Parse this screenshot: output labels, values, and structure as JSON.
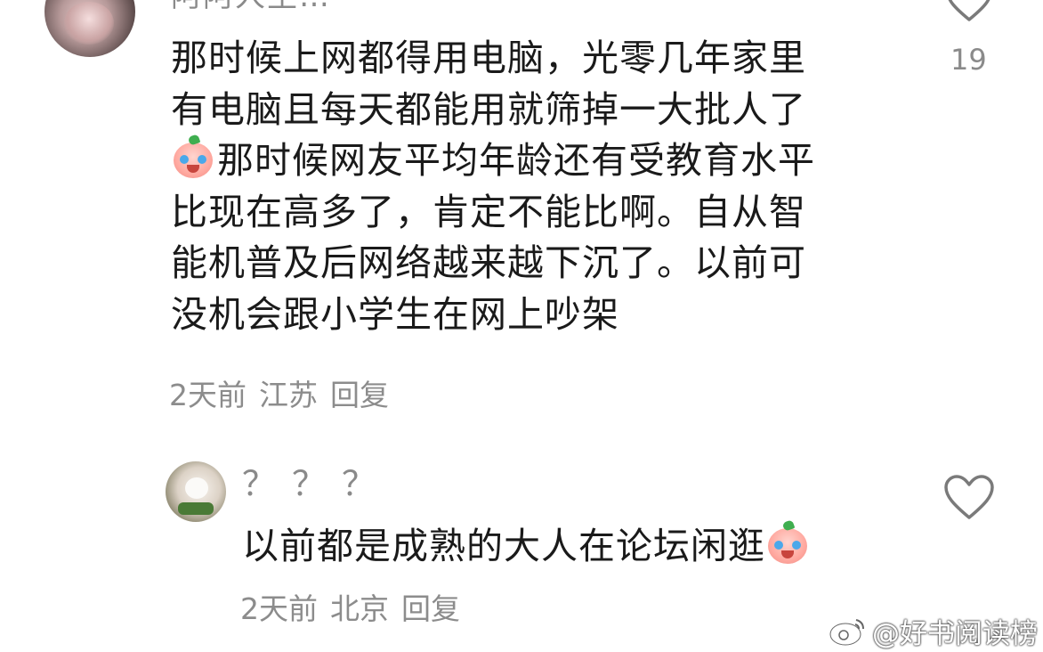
{
  "comment1": {
    "username": "阿阿人生…",
    "text_lines": [
      "那时候上网都得用电脑，光零几年家里",
      "有电脑且每天都能用就筛掉一大批人了",
      "那时候网友平均年龄还有受教育水平",
      "比现在高多了，肯定不能比啊。自从智",
      "能机普及后网络越来越下沉了。以前可",
      "没机会跟小学生在网上吵架"
    ],
    "emoji_icon": "crying-laughing-peach-emoji",
    "time": "2天前",
    "location": "江苏",
    "reply_label": "回复",
    "like_count": "19"
  },
  "comment2": {
    "username": "？？？",
    "text": "以前都是成熟的大人在论坛闲逛",
    "emoji_icon": "crying-laughing-peach-emoji",
    "time": "2天前",
    "location": "北京",
    "reply_label": "回复"
  },
  "watermark": {
    "text": "@好书阅读榜",
    "icon": "weibo-icon"
  },
  "colors": {
    "text": "#1a1a1a",
    "meta": "#8c8c8c",
    "icon_stroke": "#7a7a7a"
  }
}
